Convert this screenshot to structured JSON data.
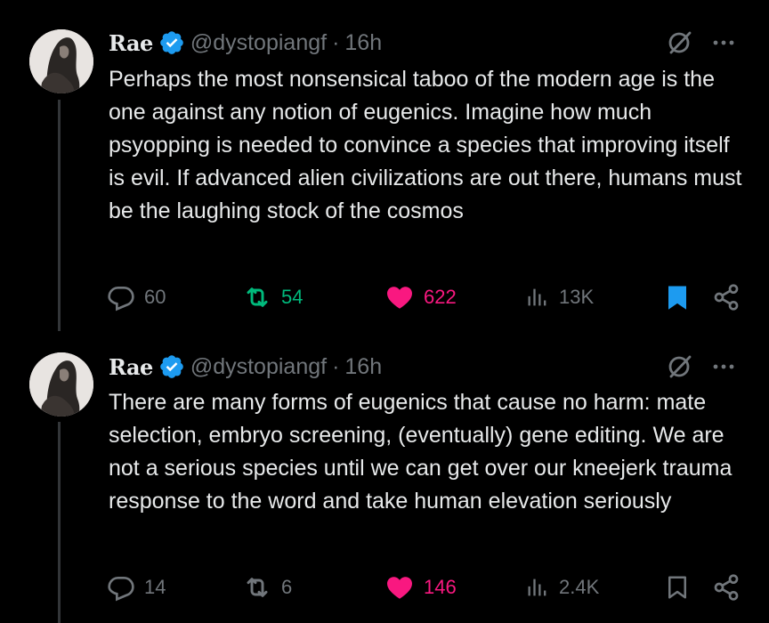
{
  "colors": {
    "background": "#000000",
    "text": "#e7e9ea",
    "muted": "#71767b",
    "verified_blue": "#1d9bf0",
    "retweet_green": "#00ba7c",
    "like_pink": "#f91880",
    "bookmark_blue": "#1d9bf0"
  },
  "tweets": [
    {
      "display_name": "Rae",
      "handle": "@dystopiangf",
      "separator": "·",
      "time": "16h",
      "text": "Perhaps the most nonsensical taboo of the modern age is the one against any notion of eugenics. Imagine how much psyopping is needed to convince a species that improving itself is evil. If advanced alien civilizations are out there, humans must be the laughing stock of the cosmos",
      "replies": "60",
      "retweets": "54",
      "likes": "622",
      "views": "13K",
      "retweeted": true,
      "liked": true,
      "bookmarked": true
    },
    {
      "display_name": "Rae",
      "handle": "@dystopiangf",
      "separator": "·",
      "time": "16h",
      "text": "There are many forms of eugenics that cause no harm: mate selection, embryo screening, (eventually) gene editing. We are not a serious species until we can get over our kneejerk trauma response to the word and take human elevation seriously",
      "replies": "14",
      "retweets": "6",
      "likes": "146",
      "views": "2.4K",
      "retweeted": false,
      "liked": true,
      "bookmarked": false
    }
  ],
  "icons": [
    "verified-badge-icon",
    "grok-icon",
    "more-icon",
    "reply-icon",
    "retweet-icon",
    "like-icon",
    "views-icon",
    "bookmark-icon",
    "share-icon"
  ]
}
